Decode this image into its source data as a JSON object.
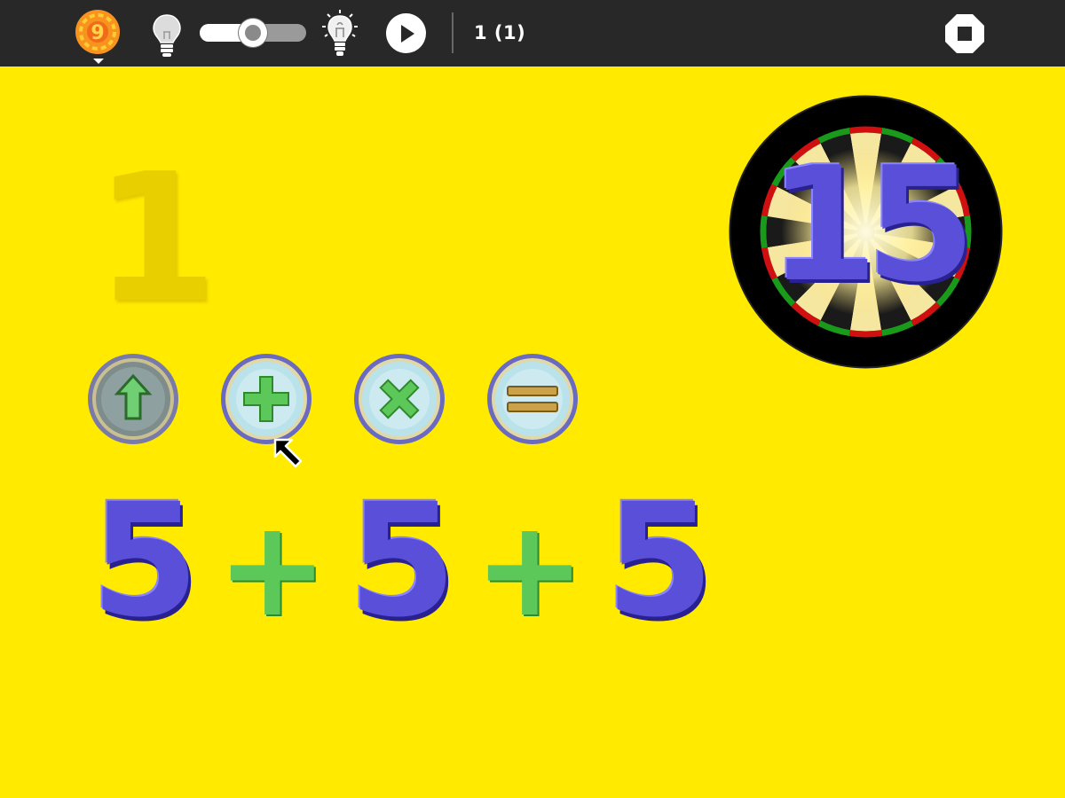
{
  "toolbar": {
    "activity_icon_digit": "9",
    "level_label": "1 (1)",
    "hint_slider_value": 0.5,
    "icons": [
      "activity-icon",
      "bulb-off-icon",
      "bulb-on-icon",
      "play-icon",
      "stop-icon"
    ]
  },
  "game": {
    "current_number": "1",
    "target_number": "15",
    "operation_buttons": [
      {
        "name": "up-arrow-icon",
        "state": "pressed"
      },
      {
        "name": "plus-icon",
        "state": "normal"
      },
      {
        "name": "multiply-icon",
        "state": "normal"
      },
      {
        "name": "equals-icon",
        "state": "normal"
      }
    ],
    "equation": [
      "5",
      "+",
      "5",
      "+",
      "5"
    ]
  },
  "colors": {
    "background": "#ffea00",
    "toolbar": "#282828",
    "digit_blue": "#5a4fd8",
    "plus_green": "#5cc85a",
    "faded_digit": "#e8cf00"
  }
}
